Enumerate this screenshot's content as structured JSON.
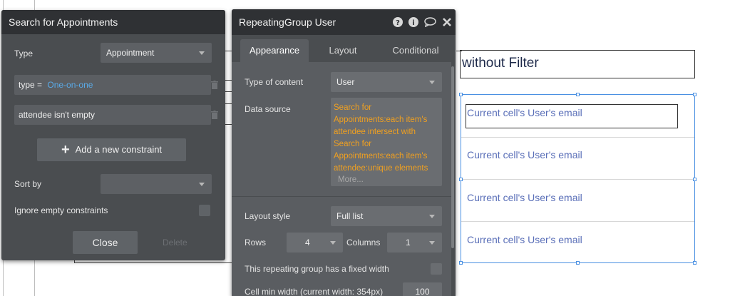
{
  "search_panel": {
    "title": "Search for Appointments",
    "type_label": "Type",
    "type_value": "Appointment",
    "constraint1_key": "type =",
    "constraint1_value": "One-on-one",
    "constraint2": "attendee isn't empty",
    "add_constraint": "Add a new constraint",
    "sort_by_label": "Sort by",
    "sort_by_value": "",
    "ignore_empty_label": "Ignore empty constraints",
    "close_label": "Close",
    "delete_label": "Delete"
  },
  "rg_panel": {
    "title": "RepeatingGroup User",
    "tabs": [
      "Appearance",
      "Layout",
      "Conditional"
    ],
    "type_of_content_label": "Type of content",
    "type_of_content_value": "User",
    "data_source_label": "Data source",
    "data_source_lines": [
      "Search for",
      "Appointments:each item's",
      "attendee intersect with",
      "Search for",
      "Appointments:each item's",
      "attendee:unique elements"
    ],
    "more_label": "More...",
    "layout_style_label": "Layout style",
    "layout_style_value": "Full list",
    "rows_label": "Rows",
    "rows_value": "4",
    "columns_label": "Columns",
    "columns_value": "1",
    "fixed_width_label": "This repeating group has a fixed width",
    "cell_min_width_label": "Cell min width (current width: 354px)",
    "cell_min_width_value": "100"
  },
  "canvas": {
    "filter_title": "without Filter",
    "cells": [
      "Current cell's User's email",
      "Current cell's User's email",
      "Current cell's User's email",
      "Current cell's User's email"
    ]
  },
  "colors": {
    "panel_bg": "#4a4d50",
    "header_bg": "#2f3134",
    "data_source_text": "#f0a020",
    "link_blue": "#5aa9e6",
    "cell_text": "#5a6fb8",
    "selection_blue": "#4a90e2"
  },
  "icons": [
    "help-icon",
    "info-icon",
    "comment-icon",
    "close-icon",
    "trash-icon",
    "plus-icon",
    "chevron-down-icon"
  ]
}
